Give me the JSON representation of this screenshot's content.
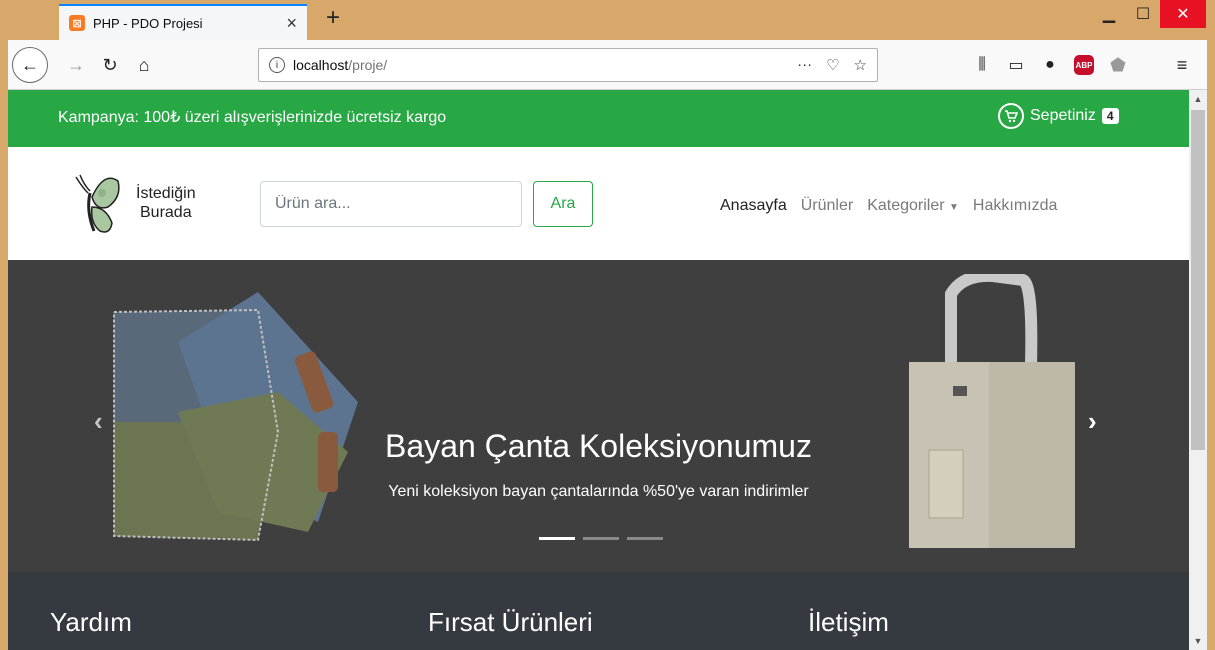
{
  "browser": {
    "tab_title": "PHP - PDO Projesi",
    "tab_favicon": "xampp-icon",
    "new_tab": "+",
    "close_tab": "×",
    "url_host": "localhost",
    "url_path": "/proje/",
    "url_more": "···"
  },
  "promo": {
    "text": "Kampanya: 100₺ üzeri alışverişlerinizde ücretsiz kargo",
    "cart_label": "Sepetiniz",
    "cart_count": "4"
  },
  "header": {
    "logo_line1": "İstediğin",
    "logo_line2": "Burada",
    "search_placeholder": "Ürün ara...",
    "search_button": "Ara",
    "menu": [
      "Anasayfa",
      "Ürünler",
      "Kategoriler",
      "Hakkımızda"
    ]
  },
  "carousel": {
    "title": "Bayan Çanta Koleksiyonumuz",
    "subtitle": "Yeni koleksiyon bayan çantalarında %50'ye varan indirimler",
    "slides": 3,
    "active_slide": 1
  },
  "footer": {
    "columns": [
      "Yardım",
      "Fırsat Ürünleri",
      "İletişim"
    ]
  },
  "colors": {
    "promo_bg": "#28a745",
    "carousel_bg": "#3f3f3f",
    "footer_bg": "#343a40"
  }
}
